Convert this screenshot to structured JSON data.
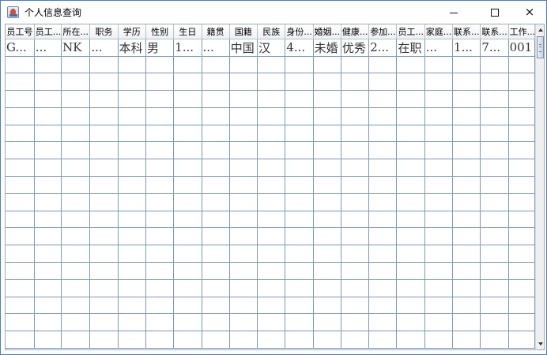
{
  "window": {
    "title": "个人信息查询",
    "minimize_icon": "minimize-icon",
    "maximize_icon": "maximize-icon",
    "close_icon": "close-icon",
    "close_label": "×"
  },
  "table": {
    "columns": [
      "员工号",
      "员工...",
      "所在...",
      "职务",
      "学历",
      "性别",
      "生日",
      "籍贯",
      "国籍",
      "民族",
      "身份...",
      "婚姻...",
      "健康...",
      "参加...",
      "员工...",
      "家庭...",
      "联系...",
      "联系...",
      "工作..."
    ],
    "rows": [
      [
        "G...",
        "...",
        "NK",
        "...",
        "本科",
        "男",
        "1...",
        "...",
        "中国",
        "汉",
        "4...",
        "未婚",
        "优秀",
        "2...",
        "在职",
        "...",
        "1...",
        "7...",
        "001"
      ],
      [
        "",
        "",
        "",
        "",
        "",
        "",
        "",
        "",
        "",
        "",
        "",
        "",
        "",
        "",
        "",
        "",
        "",
        "",
        ""
      ],
      [
        "",
        "",
        "",
        "",
        "",
        "",
        "",
        "",
        "",
        "",
        "",
        "",
        "",
        "",
        "",
        "",
        "",
        "",
        ""
      ],
      [
        "",
        "",
        "",
        "",
        "",
        "",
        "",
        "",
        "",
        "",
        "",
        "",
        "",
        "",
        "",
        "",
        "",
        "",
        ""
      ],
      [
        "",
        "",
        "",
        "",
        "",
        "",
        "",
        "",
        "",
        "",
        "",
        "",
        "",
        "",
        "",
        "",
        "",
        "",
        ""
      ],
      [
        "",
        "",
        "",
        "",
        "",
        "",
        "",
        "",
        "",
        "",
        "",
        "",
        "",
        "",
        "",
        "",
        "",
        "",
        ""
      ],
      [
        "",
        "",
        "",
        "",
        "",
        "",
        "",
        "",
        "",
        "",
        "",
        "",
        "",
        "",
        "",
        "",
        "",
        "",
        ""
      ],
      [
        "",
        "",
        "",
        "",
        "",
        "",
        "",
        "",
        "",
        "",
        "",
        "",
        "",
        "",
        "",
        "",
        "",
        "",
        ""
      ],
      [
        "",
        "",
        "",
        "",
        "",
        "",
        "",
        "",
        "",
        "",
        "",
        "",
        "",
        "",
        "",
        "",
        "",
        "",
        ""
      ],
      [
        "",
        "",
        "",
        "",
        "",
        "",
        "",
        "",
        "",
        "",
        "",
        "",
        "",
        "",
        "",
        "",
        "",
        "",
        ""
      ],
      [
        "",
        "",
        "",
        "",
        "",
        "",
        "",
        "",
        "",
        "",
        "",
        "",
        "",
        "",
        "",
        "",
        "",
        "",
        ""
      ],
      [
        "",
        "",
        "",
        "",
        "",
        "",
        "",
        "",
        "",
        "",
        "",
        "",
        "",
        "",
        "",
        "",
        "",
        "",
        ""
      ],
      [
        "",
        "",
        "",
        "",
        "",
        "",
        "",
        "",
        "",
        "",
        "",
        "",
        "",
        "",
        "",
        "",
        "",
        "",
        ""
      ],
      [
        "",
        "",
        "",
        "",
        "",
        "",
        "",
        "",
        "",
        "",
        "",
        "",
        "",
        "",
        "",
        "",
        "",
        "",
        ""
      ],
      [
        "",
        "",
        "",
        "",
        "",
        "",
        "",
        "",
        "",
        "",
        "",
        "",
        "",
        "",
        "",
        "",
        "",
        "",
        ""
      ],
      [
        "",
        "",
        "",
        "",
        "",
        "",
        "",
        "",
        "",
        "",
        "",
        "",
        "",
        "",
        "",
        "",
        "",
        "",
        ""
      ],
      [
        "",
        "",
        "",
        "",
        "",
        "",
        "",
        "",
        "",
        "",
        "",
        "",
        "",
        "",
        "",
        "",
        "",
        "",
        ""
      ],
      [
        "",
        "",
        "",
        "",
        "",
        "",
        "",
        "",
        "",
        "",
        "",
        "",
        "",
        "",
        "",
        "",
        "",
        "",
        ""
      ]
    ]
  },
  "scrollbar": {
    "up_icon": "scroll-up-arrow-icon",
    "down_icon": "scroll-down-arrow-icon"
  },
  "colors": {
    "window_border": "#4a7dc4",
    "grid_line": "#7b9ab8",
    "cell_text": "#333333"
  }
}
